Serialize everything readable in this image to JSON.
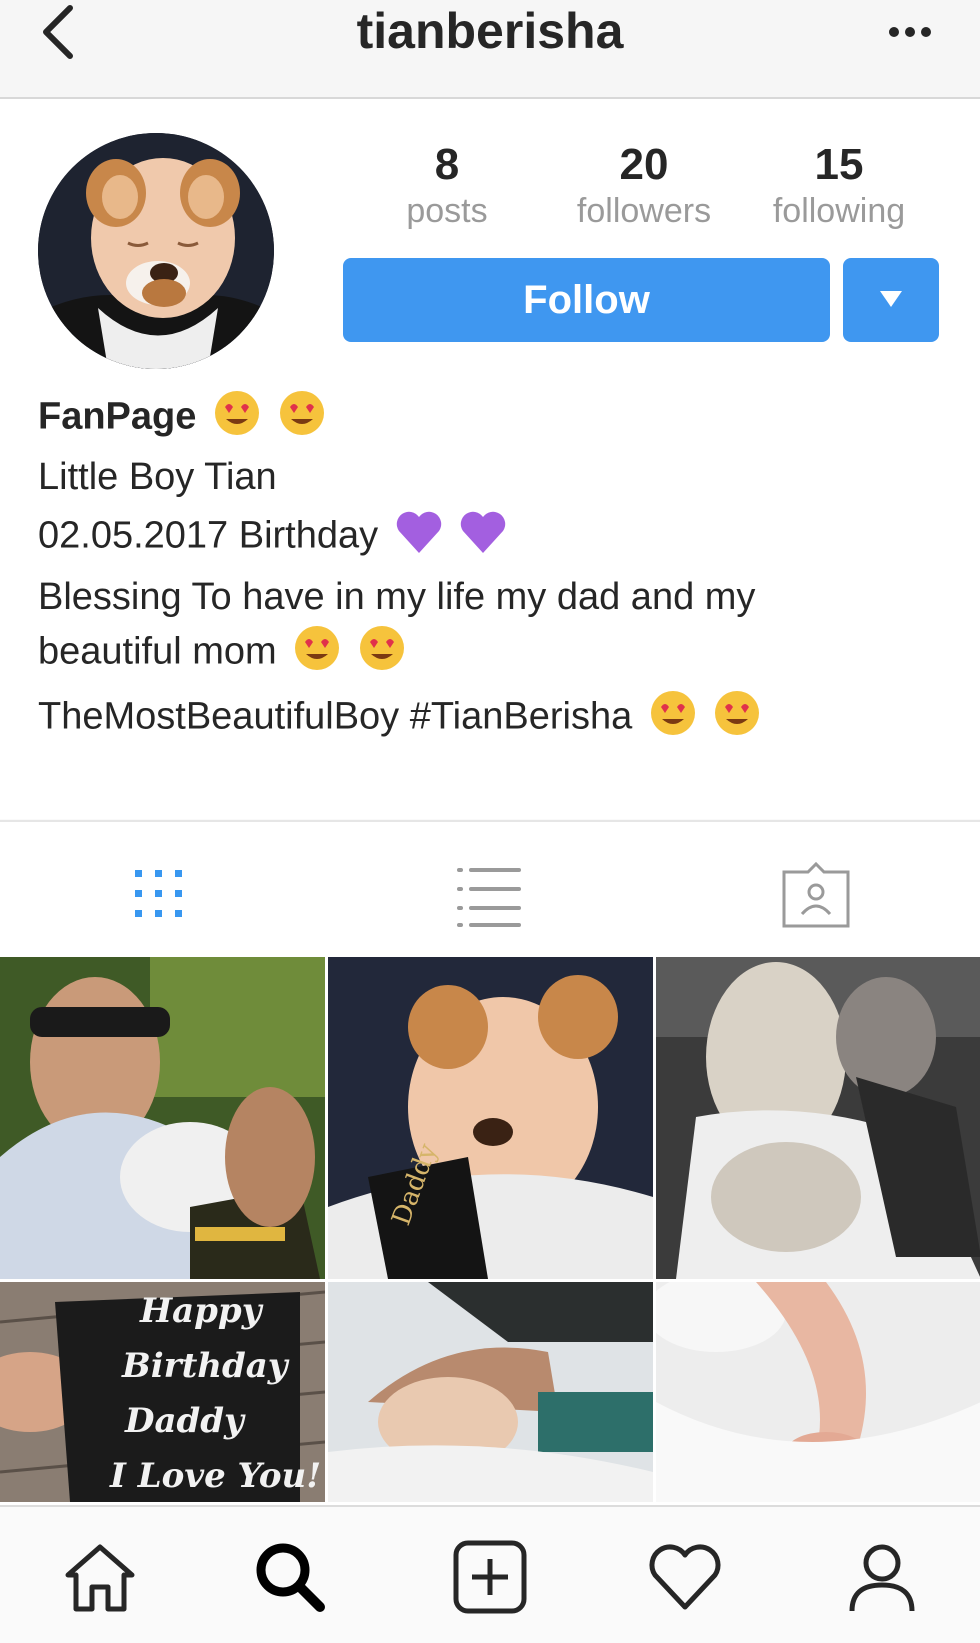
{
  "header": {
    "username": "tianberisha"
  },
  "stats": [
    {
      "count": "8",
      "label": "posts"
    },
    {
      "count": "20",
      "label": "followers"
    },
    {
      "count": "15",
      "label": "following"
    }
  ],
  "follow_label": "Follow",
  "bio": {
    "name": "FanPage",
    "line1": "Little Boy Tian",
    "line2": "02.05.2017 Birthday",
    "line3": "Blessing To have in my life my dad and my",
    "line4": "beautiful mom",
    "line5": "TheMostBeautifulBoy #TianBerisha"
  },
  "grid_text": {
    "shirt": [
      "Happy",
      "Birthday",
      "Daddy",
      "I Love You!"
    ]
  },
  "colors": {
    "accent": "#3f97f0",
    "tab_active": "#3897f0"
  }
}
